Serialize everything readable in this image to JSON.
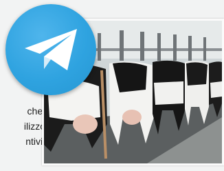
{
  "article": {
    "lines": [
      "che,",
      "ilizzo",
      "ntivi."
    ]
  },
  "colors": {
    "telegram_blue": "#2ca5e0",
    "page_background": "#f2f3f3"
  },
  "icons": {
    "app_icon": "telegram-paper-plane-icon"
  }
}
